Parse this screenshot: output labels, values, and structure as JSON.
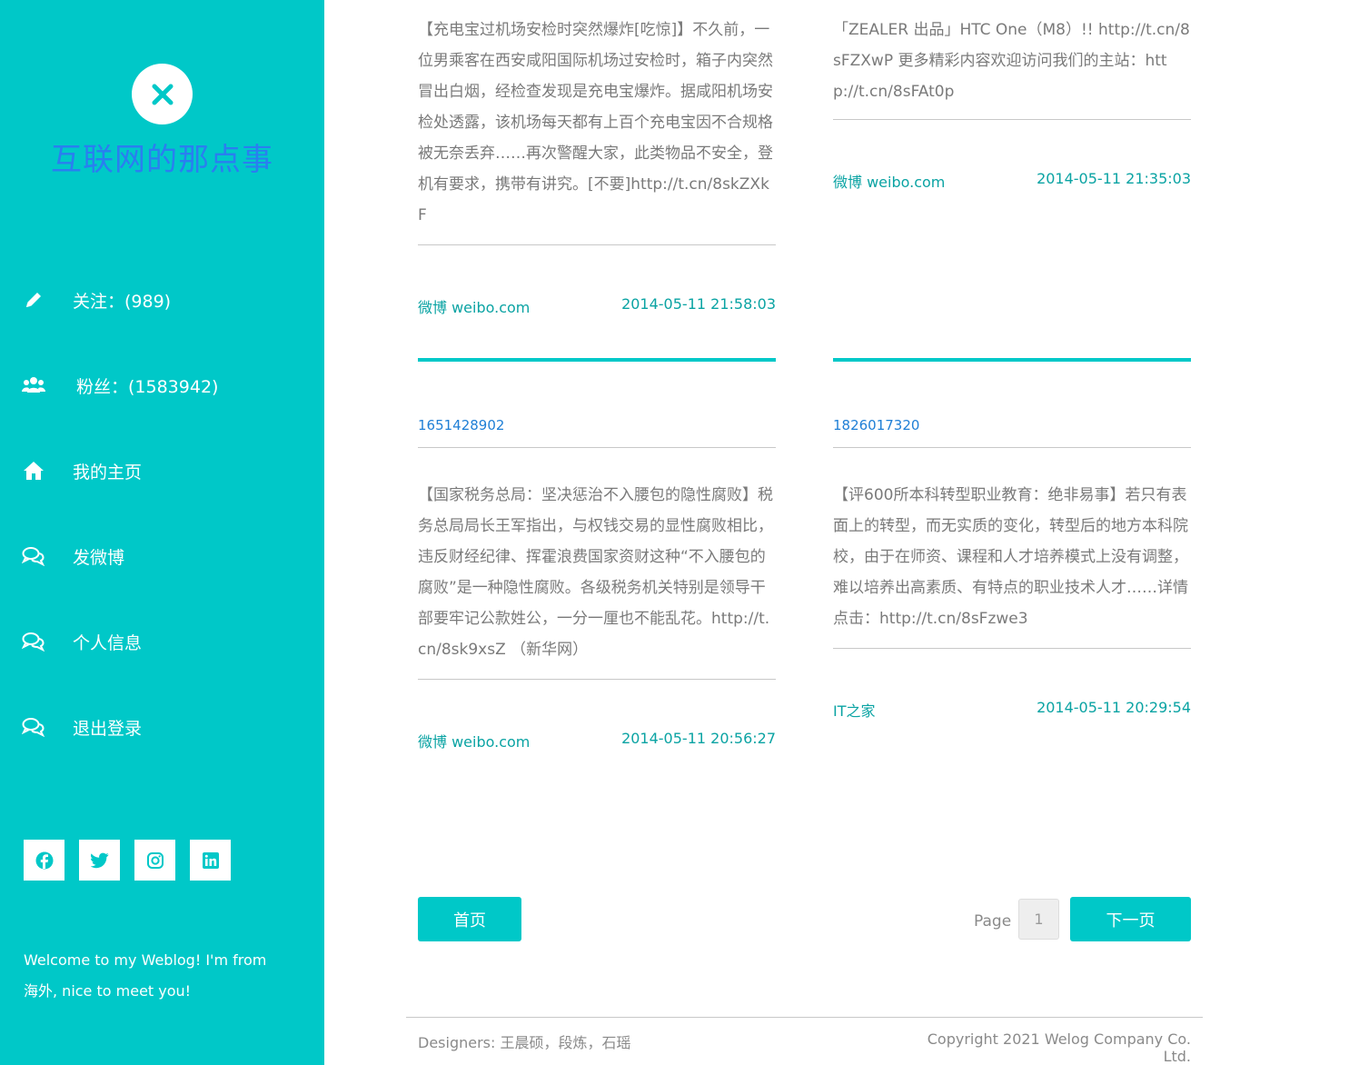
{
  "sidebar": {
    "title": "互联网的那点事",
    "nav": [
      {
        "label": "关注：(989)",
        "icon": "pencil-icon"
      },
      {
        "label": "粉丝：(1583942)",
        "icon": "users-icon"
      },
      {
        "label": "我的主页",
        "icon": "home-icon"
      },
      {
        "label": "发微博",
        "icon": "chat-icon"
      },
      {
        "label": "个人信息",
        "icon": "chat-icon"
      },
      {
        "label": "退出登录",
        "icon": "chat-icon"
      }
    ],
    "social": [
      "facebook-icon",
      "twitter-icon",
      "instagram-icon",
      "linkedin-icon"
    ],
    "welcome": "Welcome to my Weblog! I'm from 海外, nice to meet you!"
  },
  "posts": [
    {
      "text": "【充电宝过机场安检时突然爆炸[吃惊]】不久前，一位男乘客在西安咸阳国际机场过安检时，箱子内突然冒出白烟，经检查发现是充电宝爆炸。据咸阳机场安检处透露，该机场每天都有上百个充电宝因不合规格被无奈丢弃……再次警醒大家，此类物品不安全，登机有要求，携带有讲究。[不要]http://t.cn/8skZXkF",
      "source": "微博 weibo.com",
      "time": "2014-05-11 21:58:03"
    },
    {
      "text": "「ZEALER 出品」HTC One（M8）!! http://t.cn/8sFZXwP 更多精彩内容欢迎访问我们的主站：http://t.cn/8sFAt0p",
      "source": "微博 weibo.com",
      "time": "2014-05-11 21:35:03"
    },
    {
      "author": "1651428902",
      "text": "【国家税务总局：坚决惩治不入腰包的隐性腐败】税务总局局长王军指出，与权钱交易的显性腐败相比，违反财经纪律、挥霍浪费国家资财这种“不入腰包的腐败”是一种隐性腐败。各级税务机关特别是领导干部要牢记公款姓公，一分一厘也不能乱花。http://t.cn/8sk9xsZ （新华网）",
      "source": "微博 weibo.com",
      "time": "2014-05-11 20:56:27"
    },
    {
      "author": "1826017320",
      "text": "【评600所本科转型职业教育：绝非易事】若只有表面上的转型，而无实质的变化，转型后的地方本科院校，由于在师资、课程和人才培养模式上没有调整，难以培养出高素质、有特点的职业技术人才……详情点击：http://t.cn/8sFzwe3",
      "source": "IT之家",
      "time": "2014-05-11 20:29:54"
    }
  ],
  "pagination": {
    "home_label": "首页",
    "page_label": "Page",
    "page_value": "1",
    "next_label": "下一页"
  },
  "footer": {
    "designers": "Designers: 王晨硕，段炼，石瑶",
    "copyright": "Copyright 2021 Welog Company Co. Ltd."
  },
  "colors": {
    "accent": "#00c8c8",
    "title": "#2a7ef0",
    "link": "#0aa3a3"
  }
}
